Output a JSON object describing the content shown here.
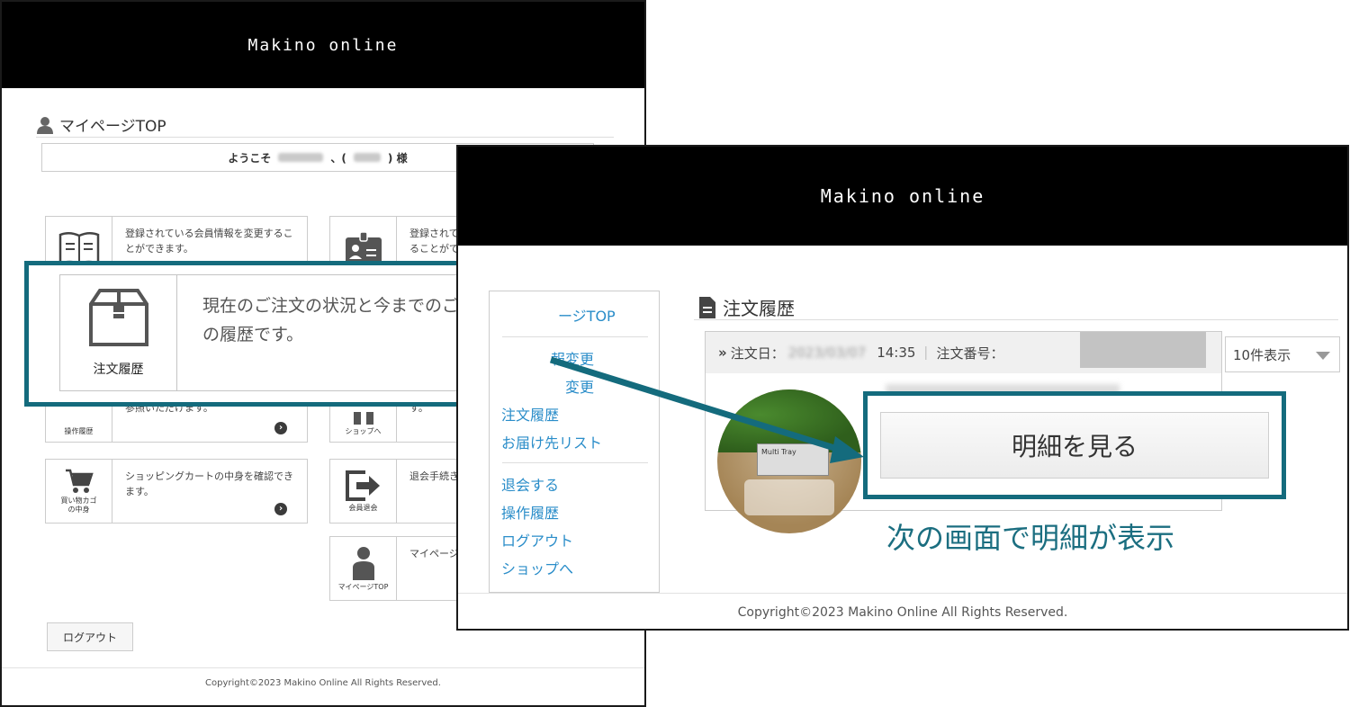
{
  "brand": "Makino online",
  "back": {
    "mypage_title": "マイページTOP",
    "welcome_prefix": "ようこそ",
    "welcome_sep": "、(",
    "welcome_suffix": ") 様",
    "cards": [
      {
        "label": "",
        "desc": "登録されている会員情報を変更することができます。"
      },
      {
        "label": "",
        "desc": "登録されて\nることがで"
      },
      {
        "label": "操作履歴",
        "desc": "参照いただけます。"
      },
      {
        "label": "ショップへ",
        "desc": "す。"
      },
      {
        "label": "買い物カゴの中身",
        "desc": "ショッピングカートの中身を確認できます。"
      },
      {
        "label": "会員退会",
        "desc": "退会手続き"
      },
      {
        "label": "マイページTOP",
        "desc": "マイページ"
      }
    ],
    "logout": "ログアウト",
    "copyright": "Copyright©2023 Makino Online All Rights Reserved."
  },
  "zoom": {
    "label": "注文履歴",
    "desc": "現在のご注文の状況と今までのご注文の履歴です。"
  },
  "front": {
    "sidebar": {
      "top": "ージTOP",
      "items": [
        "報変更",
        "変更",
        "注文履歴",
        "お届け先リスト"
      ],
      "items2": [
        "退会する",
        "操作履歴",
        "ログアウト",
        "ショップへ"
      ]
    },
    "title": "注文履歴",
    "order": {
      "date_label": "注文日：",
      "date_value": "2023/03/07",
      "time": "14:35",
      "num_label": "注文番号："
    },
    "photo_text": "Multi Tray",
    "per_page": "10件表示",
    "detail_button": "明細を見る",
    "caption": "次の画面で明細が表示",
    "copyright": "Copyright©2023 Makino Online All Rights Reserved."
  },
  "colors": {
    "accent": "#146b7d",
    "link": "#2a8dc9",
    "header": "#000000"
  }
}
